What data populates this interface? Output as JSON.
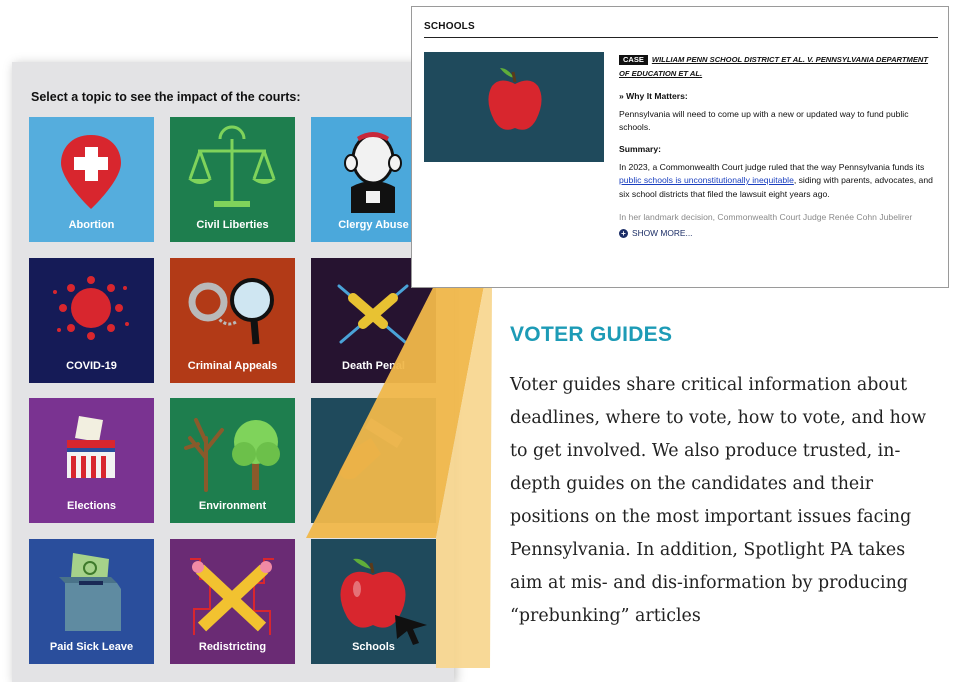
{
  "panel": {
    "title": "Select a topic to see the impact of the courts:",
    "tiles": [
      {
        "label": "Abortion",
        "icon": "map-pin-cross-icon",
        "bg": "#4ba8db"
      },
      {
        "label": "Civil Liberties",
        "icon": "scales-icon",
        "bg": "#1e7e4e"
      },
      {
        "label": "Clergy Abuse",
        "icon": "priest-icon",
        "bg": "#4ba8db"
      },
      {
        "label": "COVID-19",
        "icon": "virus-icon",
        "bg": "#151b57"
      },
      {
        "label": "Criminal Appeals",
        "icon": "handcuffs-magnifier-icon",
        "bg": "#b23a17"
      },
      {
        "label": "Death Penal",
        "icon": "syringes-icon",
        "bg": "#261330"
      },
      {
        "label": "Elections",
        "icon": "ballot-box-icon",
        "bg": "#7a3391"
      },
      {
        "label": "Environment",
        "icon": "trees-icon",
        "bg": "#1e7e4e"
      },
      {
        "label": "",
        "icon": "gun-icon",
        "bg": "#1f4a5c"
      },
      {
        "label": "Paid Sick Leave",
        "icon": "money-box-icon",
        "bg": "#2a4e9c"
      },
      {
        "label": "Redistricting",
        "icon": "pencils-icon",
        "bg": "#6a2b74"
      },
      {
        "label": "Schools",
        "icon": "apple-icon",
        "bg": "#1f4a5c"
      }
    ]
  },
  "card": {
    "heading": "SCHOOLS",
    "tag": "CASE",
    "case_title": "WILLIAM PENN SCHOOL DISTRICT ET AL. V. PENNSYLVANIA DEPARTMENT OF EDUCATION ET AL.",
    "why_heading": "» Why It Matters:",
    "why_text": "Pennsylvania will need to come up with a new or updated way to fund public schools.",
    "summary_heading": "Summary:",
    "summary_pre": "In 2023, a Commonwealth Court judge ruled that the way Pennsylvania funds its ",
    "summary_link": "public schools is unconstitutionally inequitable",
    "summary_post": ", siding with parents, advocates, and six school districts that filed the lawsuit eight years ago.",
    "fade_text": "In her landmark decision, Commonwealth Court Judge Renée Cohn Jubelirer",
    "show_more": "SHOW MORE..."
  },
  "voter": {
    "title": "VOTER GUIDES",
    "text": "Voter guides share critical information about deadlines, where to vote, how to vote, and how to get involved. We also produce trusted, in-depth guides on the candidates and their positions on the most important issues facing Pennsylvania. In addition, Spotlight PA takes aim at mis- and dis-information by producing “prebunking” articles"
  },
  "colors": {
    "accent": "#1d9bb6",
    "callout": "#f0b74a"
  }
}
